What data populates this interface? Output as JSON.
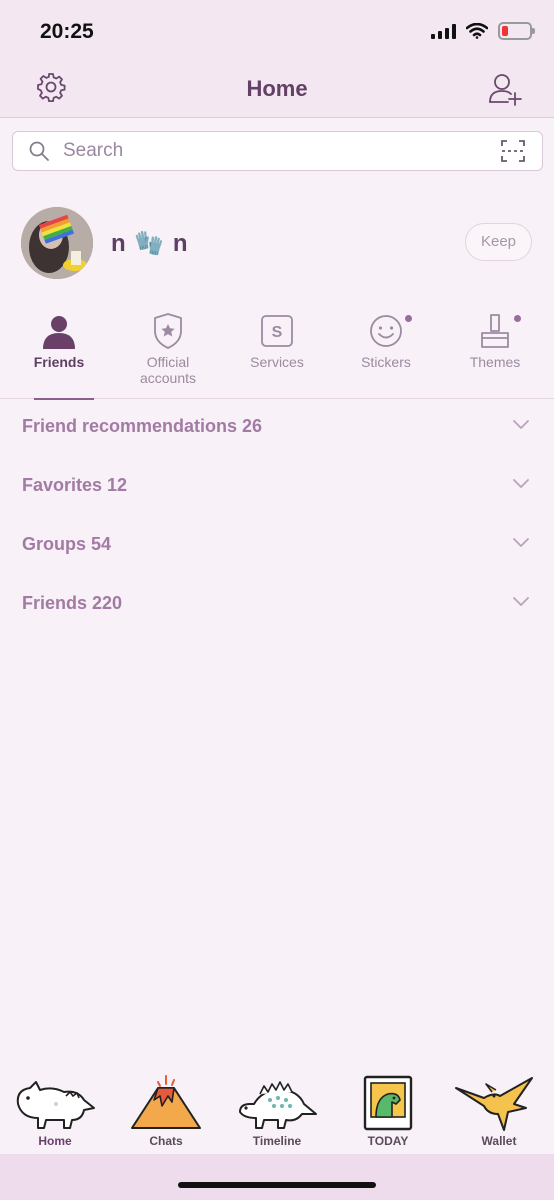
{
  "status_bar": {
    "time": "20:25"
  },
  "header": {
    "title": "Home"
  },
  "search": {
    "placeholder": "Search"
  },
  "profile": {
    "name": "n 🧤 n",
    "keep_label": "Keep"
  },
  "tabs": [
    {
      "label": "Friends",
      "icon": "person-icon",
      "active": true
    },
    {
      "label": "Official\naccounts",
      "icon": "shield-star-icon"
    },
    {
      "label": "Services",
      "icon": "services-s-icon"
    },
    {
      "label": "Stickers",
      "icon": "smiley-icon",
      "badge": true
    },
    {
      "label": "Themes",
      "icon": "brush-icon",
      "badge": true
    }
  ],
  "list": [
    {
      "label": "Friend recommendations 26"
    },
    {
      "label": "Favorites 12"
    },
    {
      "label": "Groups 54"
    },
    {
      "label": "Friends 220"
    }
  ],
  "bottom_nav": [
    {
      "label": "Home",
      "icon": "dinosaur-icon",
      "active": true
    },
    {
      "label": "Chats",
      "icon": "volcano-icon"
    },
    {
      "label": "Timeline",
      "icon": "stegosaurus-icon"
    },
    {
      "label": "TODAY",
      "icon": "frame-dino-icon"
    },
    {
      "label": "Wallet",
      "icon": "pterodactyl-icon"
    }
  ],
  "colors": {
    "accent": "#643f66",
    "background": "#f8f1f7",
    "header_bg": "#f3e7f2"
  }
}
